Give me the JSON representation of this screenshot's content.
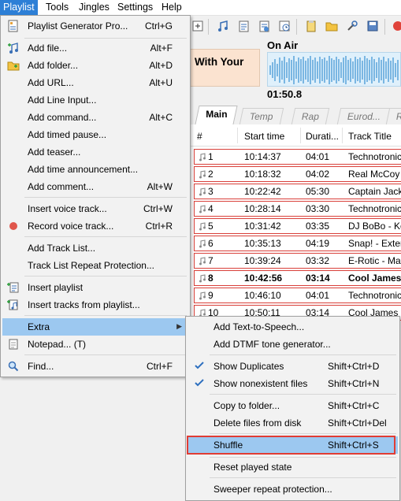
{
  "menubar": {
    "items": [
      "Playlist",
      "Tools",
      "Jingles",
      "Settings",
      "Help"
    ]
  },
  "onair": {
    "current_title": "With Your",
    "label": "On Air",
    "time": "01:50.8"
  },
  "tabs": [
    "Main",
    "Temp",
    "Rap",
    "Eurod...",
    "R"
  ],
  "table": {
    "columns": [
      "#",
      "Start time",
      "Durati...",
      "Track Title"
    ],
    "rows": [
      {
        "num": "1",
        "start": "10:14:37",
        "dur": "04:01",
        "title": "Technotronic"
      },
      {
        "num": "2",
        "start": "10:18:32",
        "dur": "04:02",
        "title": "Real McCoy -"
      },
      {
        "num": "3",
        "start": "10:22:42",
        "dur": "05:30",
        "title": "Captain Jack"
      },
      {
        "num": "4",
        "start": "10:28:14",
        "dur": "03:30",
        "title": "Technotronic"
      },
      {
        "num": "5",
        "start": "10:31:42",
        "dur": "03:35",
        "title": "DJ BoBo - Ke"
      },
      {
        "num": "6",
        "start": "10:35:13",
        "dur": "04:19",
        "title": "Snap! - Exter"
      },
      {
        "num": "7",
        "start": "10:39:24",
        "dur": "03:32",
        "title": "E-Rotic - Max"
      },
      {
        "num": "8",
        "start": "10:42:56",
        "dur": "03:14",
        "title": "Cool James &"
      },
      {
        "num": "9",
        "start": "10:46:10",
        "dur": "04:01",
        "title": "Technotronic"
      },
      {
        "num": "10",
        "start": "10:50:11",
        "dur": "03:14",
        "title": "Cool James &"
      }
    ]
  },
  "playlist_menu": {
    "generator": {
      "label": "Playlist Generator Pro...",
      "shortcut": "Ctrl+G"
    },
    "add_file": {
      "label": "Add file...",
      "shortcut": "Alt+F"
    },
    "add_folder": {
      "label": "Add folder...",
      "shortcut": "Alt+D"
    },
    "add_url": {
      "label": "Add URL...",
      "shortcut": "Alt+U"
    },
    "add_line_input": {
      "label": "Add Line Input..."
    },
    "add_command": {
      "label": "Add command...",
      "shortcut": "Alt+C"
    },
    "add_timed_pause": {
      "label": "Add timed pause..."
    },
    "add_teaser": {
      "label": "Add teaser..."
    },
    "add_time_announcement": {
      "label": "Add time announcement..."
    },
    "add_comment": {
      "label": "Add comment...",
      "shortcut": "Alt+W"
    },
    "insert_voice_track": {
      "label": "Insert voice track...",
      "shortcut": "Ctrl+W"
    },
    "record_voice_track": {
      "label": "Record voice track...",
      "shortcut": "Ctrl+R"
    },
    "add_track_list": {
      "label": "Add Track List..."
    },
    "track_list_repeat": {
      "label": "Track List Repeat Protection..."
    },
    "insert_playlist": {
      "label": "Insert playlist"
    },
    "insert_tracks_from_playlist": {
      "label": "Insert tracks from playlist..."
    },
    "extra": {
      "label": "Extra"
    },
    "notepad": {
      "label": "Notepad... (T)"
    },
    "find": {
      "label": "Find...",
      "shortcut": "Ctrl+F"
    }
  },
  "extra_menu": {
    "tts": {
      "label": "Add Text-to-Speech..."
    },
    "dtmf": {
      "label": "Add DTMF tone generator..."
    },
    "show_duplicates": {
      "label": "Show Duplicates",
      "shortcut": "Shift+Ctrl+D"
    },
    "show_nonexistent": {
      "label": "Show nonexistent files",
      "shortcut": "Shift+Ctrl+N"
    },
    "copy_to_folder": {
      "label": "Copy to folder...",
      "shortcut": "Shift+Ctrl+C"
    },
    "delete_files": {
      "label": "Delete files from disk",
      "shortcut": "Shift+Ctrl+Del"
    },
    "shuffle": {
      "label": "Shuffle",
      "shortcut": "Shift+Ctrl+S"
    },
    "reset_played": {
      "label": "Reset played state"
    },
    "sweeper_repeat": {
      "label": "Sweeper repeat protection..."
    }
  },
  "colors": {
    "accent": "#2d7fd6",
    "highlight": "#9cc8f0",
    "row_border": "#d9403a",
    "annotation_red": "#e03c34"
  }
}
